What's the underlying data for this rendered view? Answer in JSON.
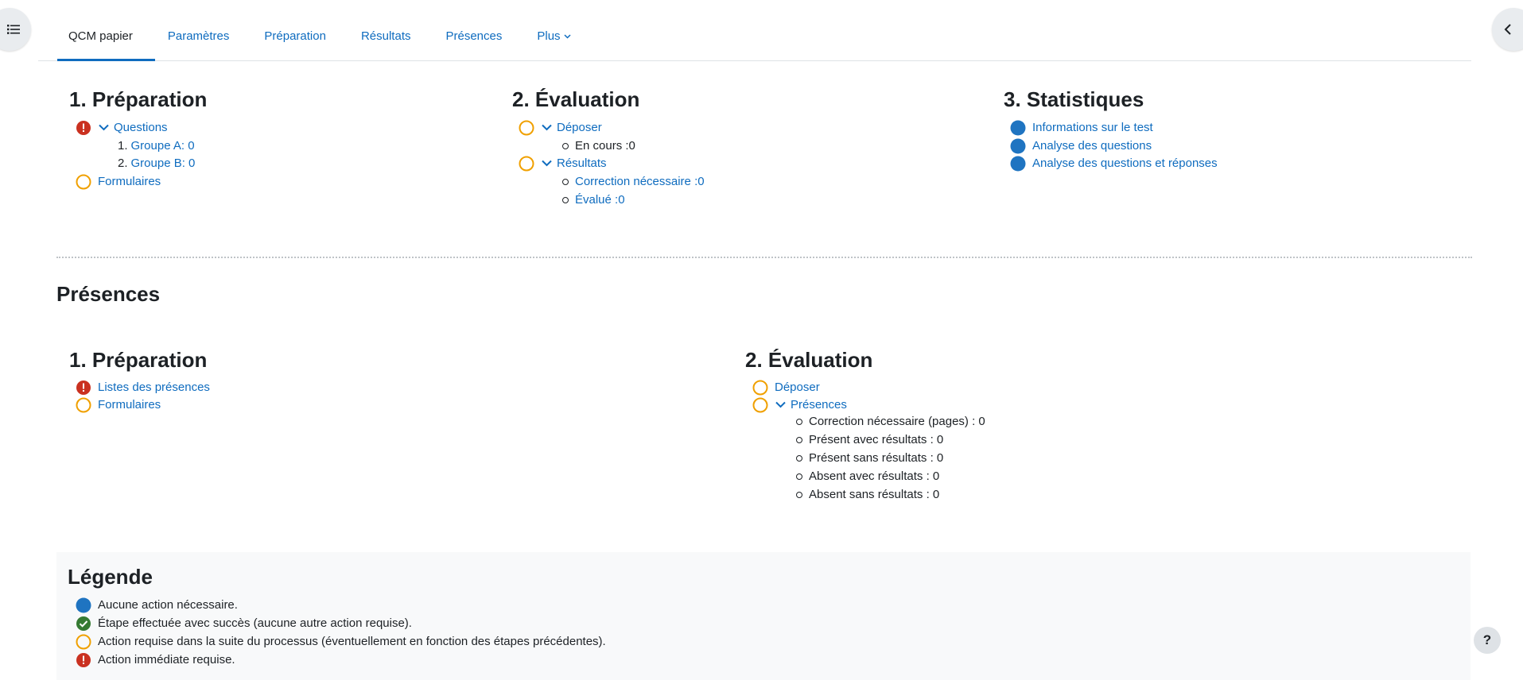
{
  "nav": {
    "tabs": [
      {
        "label": "QCM papier"
      },
      {
        "label": "Paramètres"
      },
      {
        "label": "Préparation"
      },
      {
        "label": "Résultats"
      },
      {
        "label": "Présences"
      },
      {
        "label": "Plus"
      }
    ]
  },
  "qcm": {
    "preparation": {
      "title": "1. Préparation",
      "questions": "Questions",
      "groupA": "Groupe A: 0",
      "groupB": "Groupe B: 0",
      "forms": "Formulaires",
      "num1": "1.",
      "num2": "2."
    },
    "evaluation": {
      "title": "2. Évaluation",
      "submit": "Déposer",
      "in_progress": "En cours :0",
      "results": "Résultats",
      "correction": "Correction nécessaire :0",
      "graded": "Évalué :0"
    },
    "stats": {
      "title": "3. Statistiques",
      "info": "Informations sur le test",
      "qa": "Analyse des questions",
      "qra": "Analyse des questions et réponses"
    }
  },
  "attendance": {
    "heading": "Présences",
    "preparation": {
      "title": "1. Préparation",
      "lists": "Listes des présences",
      "forms": "Formulaires"
    },
    "evaluation": {
      "title": "2. Évaluation",
      "submit": "Déposer",
      "presences": "Présences",
      "correction": "Correction nécessaire (pages) : 0",
      "present_with": "Présent avec résultats : 0",
      "present_without": "Présent sans résultats : 0",
      "absent_with": "Absent avec résultats : 0",
      "absent_without": "Absent sans résultats : 0"
    }
  },
  "legend": {
    "title": "Légende",
    "no_action": "Aucune action nécessaire.",
    "success": "Étape effectuée avec succès (aucune autre action requise).",
    "later": "Action requise dans la suite du processus (éventuellement en fonction des étapes précédentes).",
    "immediate": "Action immédiate requise."
  },
  "help": {
    "label": "?"
  },
  "colors": {
    "link": "#0f6cbf",
    "info": "#1f74c1",
    "success": "#357a32",
    "warning": "#f0a000",
    "danger": "#ca3120"
  }
}
